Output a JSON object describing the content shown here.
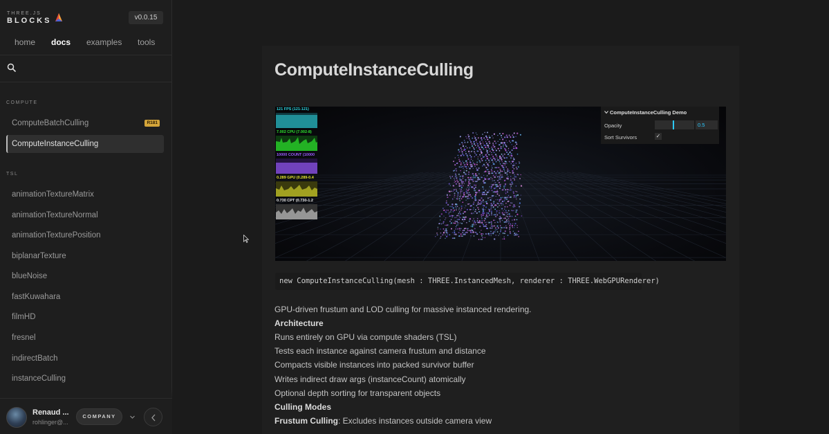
{
  "brand": {
    "small": "THREE.JS",
    "big": "BLOCKS",
    "version": "v0.0.15"
  },
  "topnav": [
    {
      "label": "home"
    },
    {
      "label": "docs"
    },
    {
      "label": "examples"
    },
    {
      "label": "tools"
    }
  ],
  "sidebar": {
    "sections": [
      {
        "title": "COMPUTE",
        "items": [
          {
            "label": "ComputeBatchCulling",
            "badge": "R181"
          },
          {
            "label": "ComputeInstanceCulling"
          }
        ]
      },
      {
        "title": "TSL",
        "items": [
          {
            "label": "animationTextureMatrix"
          },
          {
            "label": "animationTextureNormal"
          },
          {
            "label": "animationTexturePosition"
          },
          {
            "label": "biplanarTexture"
          },
          {
            "label": "blueNoise"
          },
          {
            "label": "fastKuwahara"
          },
          {
            "label": "filmHD"
          },
          {
            "label": "fresnel"
          },
          {
            "label": "indirectBatch"
          },
          {
            "label": "instanceCulling"
          }
        ]
      }
    ],
    "selected": "ComputeInstanceCulling"
  },
  "user": {
    "name": "Renaud ...",
    "email": "rohlinger@...",
    "company": "COMPANY"
  },
  "doc": {
    "title": "ComputeInstanceCulling",
    "signature": "new ComputeInstanceCulling(mesh : THREE.InstancedMesh, renderer : THREE.WebGPURenderer)",
    "lines": [
      {
        "text": "GPU-driven frustum and LOD culling for massive instanced rendering.",
        "style": "normal"
      },
      {
        "text": "Architecture",
        "style": "heading"
      },
      {
        "text": "Runs entirely on GPU via compute shaders (TSL)",
        "style": "normal"
      },
      {
        "text": "Tests each instance against camera frustum and distance",
        "style": "normal"
      },
      {
        "text": "Compacts visible instances into packed survivor buffer",
        "style": "normal"
      },
      {
        "text": "Writes indirect draw args (instanceCount) atomically",
        "style": "normal"
      },
      {
        "text": "Optional depth sorting for transparent objects",
        "style": "normal"
      },
      {
        "text": "Culling Modes",
        "style": "heading"
      }
    ],
    "frustum_term": "Frustum Culling",
    "frustum_desc": ": Excludes instances outside camera view"
  },
  "demo": {
    "stats": [
      {
        "label": "121 FPS (121-121)",
        "color": "#2fd6e0",
        "bg": "#0f3a40"
      },
      {
        "label": "7.002 CPU (7.002-8)",
        "color": "#2ee62e",
        "bg": "#0d3a10"
      },
      {
        "label": "10000 COUNT (10000",
        "color": "#9b5cff",
        "bg": "#23123f"
      },
      {
        "label": "0.289 GPU (0.289-0.4",
        "color": "#e6e62e",
        "bg": "#3a3a0d"
      },
      {
        "label": "0.730 CPT (0.730-1.2",
        "color": "#e8e8e8",
        "bg": "#333333"
      }
    ],
    "gui": {
      "title": "ComputeInstanceCulling Demo",
      "opacity_label": "Opacity",
      "opacity_value": "0.5",
      "sort_label": "Sort Survivors",
      "sort_checked": "✓"
    }
  },
  "colors": {
    "accent": "#2cc9ff",
    "badge": "#d4a53a"
  }
}
